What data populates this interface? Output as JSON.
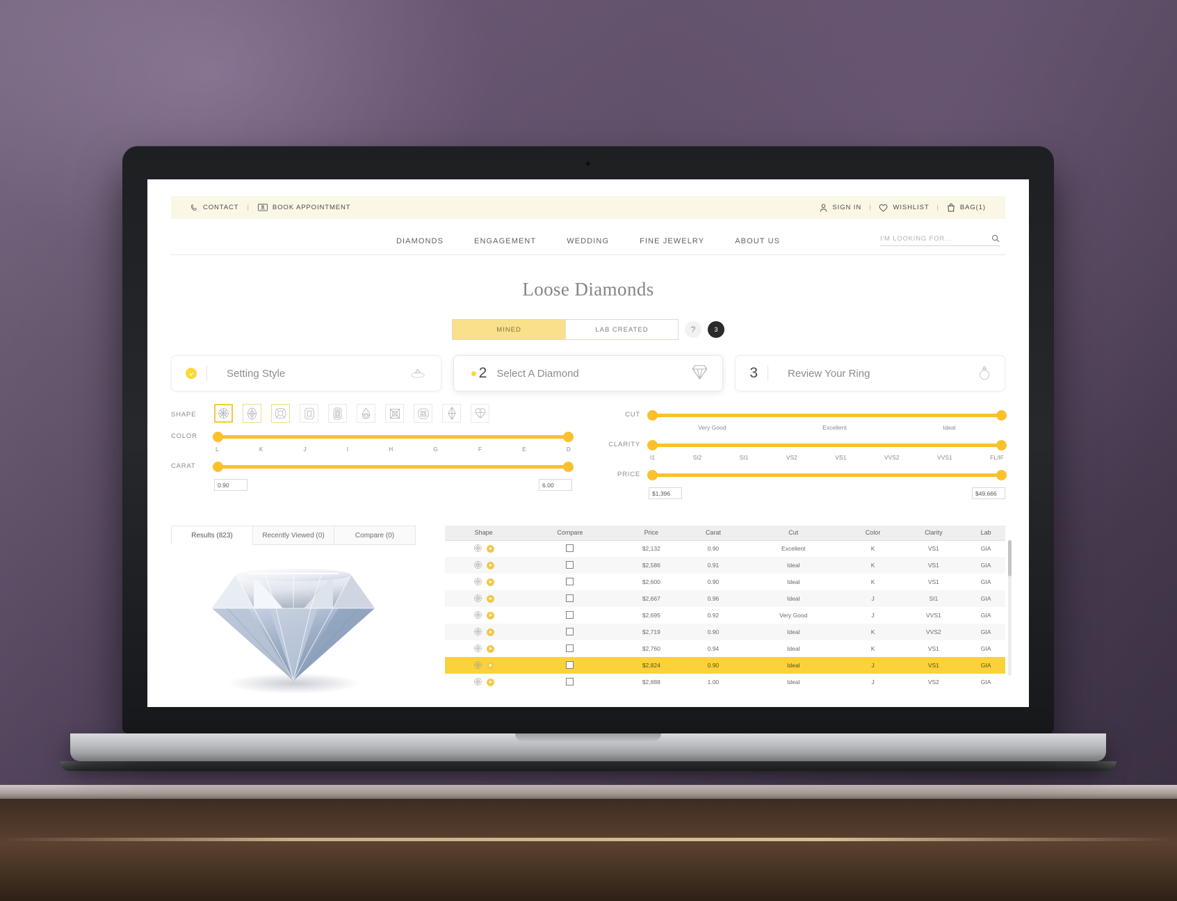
{
  "topbar": {
    "contact_label": "CONTACT",
    "book_label": "BOOK APPOINTMENT",
    "separator": "|",
    "signin_label": "SIGN IN",
    "wishlist_label": "WISHLIST",
    "bag_label": "BAG(1)"
  },
  "nav": {
    "items": [
      {
        "label": "DIAMONDS"
      },
      {
        "label": "ENGAGEMENT"
      },
      {
        "label": "WEDDING"
      },
      {
        "label": "FINE JEWELRY"
      },
      {
        "label": "ABOUT US"
      }
    ],
    "search_placeholder": "I'M LOOKING FOR...",
    "search_value": ""
  },
  "page": {
    "title": "Loose Diamonds"
  },
  "toggle": {
    "mined_label": "MINED",
    "lab_label": "LAB CREATED",
    "selected": "MINED",
    "help_label": "?",
    "step_badge": "3",
    "accent": "#fae08a"
  },
  "steps": [
    {
      "number": "",
      "label": "Setting Style",
      "state": "complete",
      "icon": "ring-setting-icon"
    },
    {
      "number": "2",
      "label": "Select A Diamond",
      "state": "active",
      "icon": "diamond-icon"
    },
    {
      "number": "3",
      "label": "Review Your Ring",
      "state": "pending",
      "icon": "ring-icon"
    }
  ],
  "filters": {
    "shape": {
      "label": "SHAPE",
      "options": [
        {
          "name": "round",
          "state": "selected"
        },
        {
          "name": "oval",
          "state": "semi"
        },
        {
          "name": "cushion",
          "state": "semi"
        },
        {
          "name": "radiant",
          "state": "off"
        },
        {
          "name": "emerald",
          "state": "off"
        },
        {
          "name": "pear",
          "state": "off"
        },
        {
          "name": "princess",
          "state": "off"
        },
        {
          "name": "asscher",
          "state": "off"
        },
        {
          "name": "marquise",
          "state": "off"
        },
        {
          "name": "heart",
          "state": "off"
        }
      ]
    },
    "color": {
      "label": "COLOR",
      "ticks": [
        "L",
        "K",
        "J",
        "I",
        "H",
        "G",
        "F",
        "E",
        "D"
      ],
      "min": "L",
      "max": "D"
    },
    "carat": {
      "label": "CARAT",
      "min": "0.90",
      "max": "6.00"
    },
    "cut": {
      "label": "CUT",
      "ticks": [
        "Very Good",
        "Excellent",
        "Ideal"
      ],
      "min": "Very Good",
      "max": "Ideal"
    },
    "clarity": {
      "label": "CLARITY",
      "ticks": [
        "I1",
        "SI2",
        "SI1",
        "VS2",
        "VS1",
        "VVS2",
        "VVS1",
        "FL/IF"
      ],
      "min": "I1",
      "max": "FL/IF"
    },
    "price": {
      "label": "PRICE",
      "min": "$1,396",
      "max": "$49,666"
    }
  },
  "results": {
    "tabs": [
      {
        "label": "Results (823)",
        "active": true
      },
      {
        "label": "Recently Viewed (0)",
        "active": false
      },
      {
        "label": "Compare (0)",
        "active": false
      }
    ],
    "columns": [
      "Shape",
      "Compare",
      "Price",
      "Carat",
      "Cut",
      "Color",
      "Clarity",
      "Lab"
    ],
    "rows": [
      {
        "shape": "round",
        "price": "$2,132",
        "carat": "0.90",
        "cut": "Excellent",
        "color": "K",
        "clarity": "VS1",
        "lab": "GIA",
        "highlighted": false
      },
      {
        "shape": "round",
        "price": "$2,586",
        "carat": "0.91",
        "cut": "Ideal",
        "color": "K",
        "clarity": "VS1",
        "lab": "GIA",
        "highlighted": false
      },
      {
        "shape": "round",
        "price": "$2,600",
        "carat": "0.90",
        "cut": "Ideal",
        "color": "K",
        "clarity": "VS1",
        "lab": "GIA",
        "highlighted": false
      },
      {
        "shape": "round",
        "price": "$2,667",
        "carat": "0.96",
        "cut": "Ideal",
        "color": "J",
        "clarity": "SI1",
        "lab": "GIA",
        "highlighted": false
      },
      {
        "shape": "round",
        "price": "$2,695",
        "carat": "0.92",
        "cut": "Very Good",
        "color": "J",
        "clarity": "VVS1",
        "lab": "GIA",
        "highlighted": false
      },
      {
        "shape": "round",
        "price": "$2,719",
        "carat": "0.90",
        "cut": "Ideal",
        "color": "K",
        "clarity": "VVS2",
        "lab": "GIA",
        "highlighted": false
      },
      {
        "shape": "round",
        "price": "$2,760",
        "carat": "0.94",
        "cut": "Ideal",
        "color": "K",
        "clarity": "VS1",
        "lab": "GIA",
        "highlighted": false
      },
      {
        "shape": "round",
        "price": "$2,824",
        "carat": "0.90",
        "cut": "Ideal",
        "color": "J",
        "clarity": "VS1",
        "lab": "GIA",
        "highlighted": true
      },
      {
        "shape": "round",
        "price": "$2,888",
        "carat": "1.00",
        "cut": "Ideal",
        "color": "J",
        "clarity": "VS2",
        "lab": "GIA",
        "highlighted": false
      }
    ]
  }
}
